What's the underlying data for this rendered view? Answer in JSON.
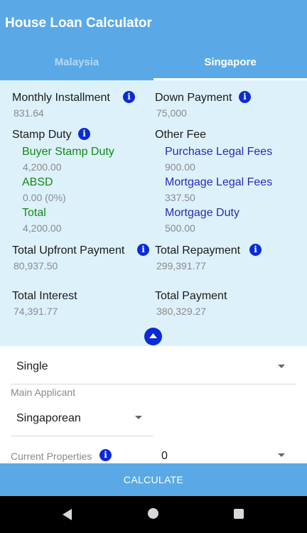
{
  "app": {
    "title": "House Loan Calculator",
    "accent_color": "#5aa9e6",
    "info_icon_color": "#0b2bd6"
  },
  "tabs": [
    {
      "label": "Malaysia",
      "selected": false
    },
    {
      "label": "Singapore",
      "selected": true
    }
  ],
  "results": {
    "monthly_installment": {
      "label": "Monthly Installment",
      "value": "831.64"
    },
    "down_payment": {
      "label": "Down Payment",
      "value": "75,000"
    },
    "stamp_duty": {
      "label": "Stamp Duty",
      "buyer_stamp_duty": {
        "label": "Buyer Stamp Duty",
        "value": "4,200.00"
      },
      "absd": {
        "label": "ABSD",
        "value": "0.00 (0%)"
      },
      "total": {
        "label": "Total",
        "value": "4,200.00"
      }
    },
    "other_fee": {
      "label": "Other Fee",
      "purchase_legal_fees": {
        "label": "Purchase Legal Fees",
        "value": "900.00"
      },
      "mortgage_legal_fees": {
        "label": "Mortgage Legal Fees",
        "value": "337.50"
      },
      "mortgage_duty": {
        "label": "Mortgage Duty",
        "value": "500.00"
      }
    },
    "total_upfront_payment": {
      "label": "Total Upfront Payment",
      "value": "80,937.50"
    },
    "total_repayment": {
      "label": "Total Repayment",
      "value": "299,391.77"
    },
    "total_interest": {
      "label": "Total Interest",
      "value": "74,391.77"
    },
    "total_payment": {
      "label": "Total Payment",
      "value": "380,329.27"
    }
  },
  "form": {
    "applicant_type": {
      "value": "Single"
    },
    "main_applicant": {
      "label": "Main Applicant",
      "value": "Singaporean"
    },
    "current_properties": {
      "label": "Current Properties",
      "value": "0"
    }
  },
  "calculate_button": {
    "label": "CALCULATE"
  },
  "icons": {
    "info": "info-icon",
    "collapse": "chevron-up-icon",
    "dropdown": "dropdown-arrow-icon"
  }
}
